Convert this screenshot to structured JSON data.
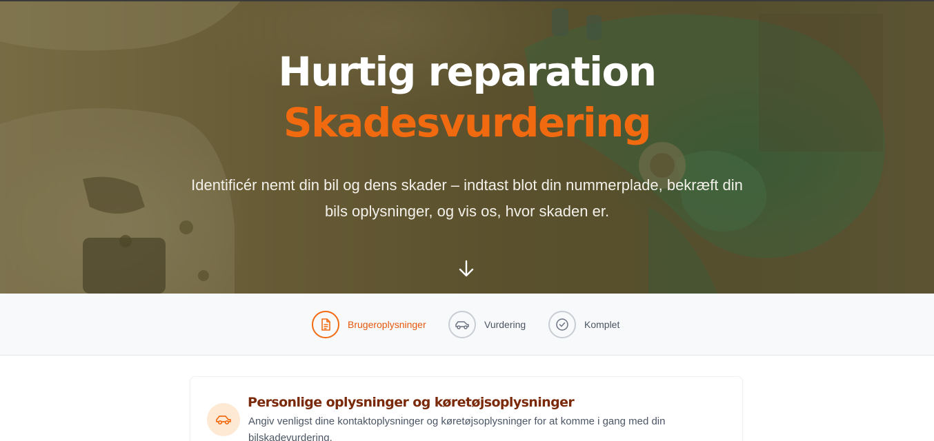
{
  "hero": {
    "title_line1": "Hurtig reparation",
    "title_line2": "Skadesvurdering",
    "subtitle": "Identificér nemt din bil og dens skader – indtast blot din nummerplade, bekræft din bils oplysninger, og vis os, hvor skaden er.",
    "scroll_icon": "arrow-down-icon"
  },
  "stepper": {
    "steps": [
      {
        "label": "Brugeroplysninger",
        "icon": "document-icon",
        "active": true
      },
      {
        "label": "Vurdering",
        "icon": "car-icon",
        "active": false
      },
      {
        "label": "Komplet",
        "icon": "check-circle-icon",
        "active": false
      }
    ]
  },
  "form_section": {
    "icon": "car-icon",
    "title": "Personlige oplysninger og køretøjsoplysninger",
    "description": "Angiv venligst dine kontaktoplysninger og køretøjsoplysninger for at komme i gang med din bilskadevurdering."
  },
  "colors": {
    "accent": "#f26a10",
    "accent_dark": "#7a2a0a",
    "hero_overlay": "#6b6040",
    "stepper_bg": "#f8f9fb",
    "icon_bg": "#fde9d4"
  }
}
